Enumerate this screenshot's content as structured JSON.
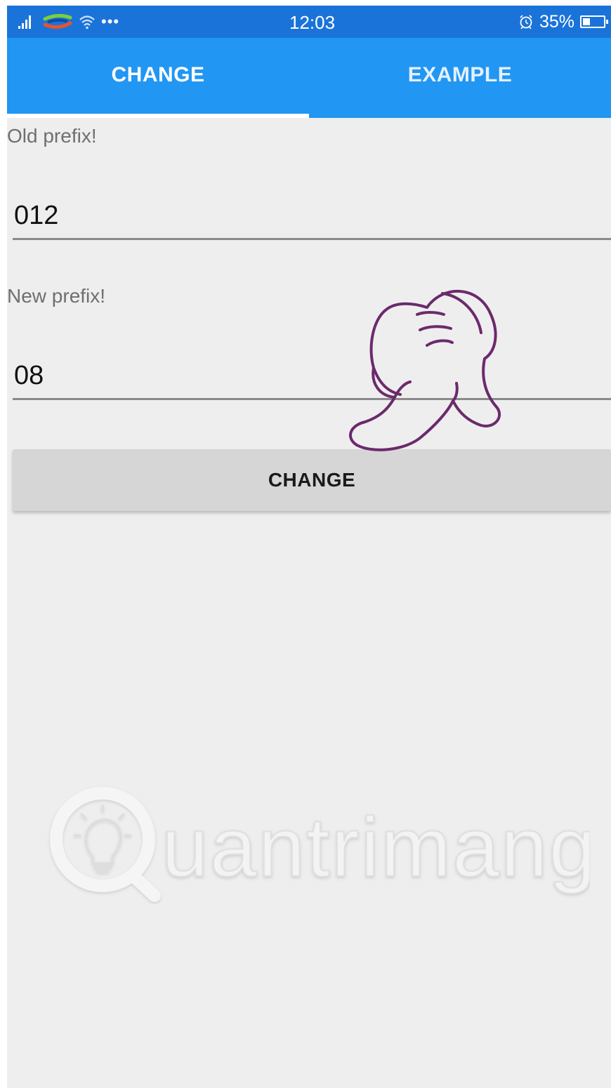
{
  "status_bar": {
    "time": "12:03",
    "battery_percent": "35%",
    "battery_level": 0.35,
    "icons": [
      "signal-icon",
      "carrier-logo-icon",
      "wifi-icon",
      "more-icon",
      "alarm-icon",
      "battery-icon"
    ]
  },
  "tabs": [
    {
      "label": "CHANGE",
      "active": true
    },
    {
      "label": "EXAMPLE",
      "active": false
    }
  ],
  "form": {
    "old_prefix_label": "Old prefix!",
    "old_prefix_value": "012",
    "new_prefix_label": "New prefix!",
    "new_prefix_value": "08",
    "button_label": "CHANGE"
  },
  "watermark": {
    "text": "uantrimang"
  },
  "colors": {
    "status_bar": "#1a73d9",
    "tab_bar": "#2196f3",
    "background": "#eeeeee",
    "button": "#d6d6d6",
    "hand_outline": "#6b2a6b"
  }
}
